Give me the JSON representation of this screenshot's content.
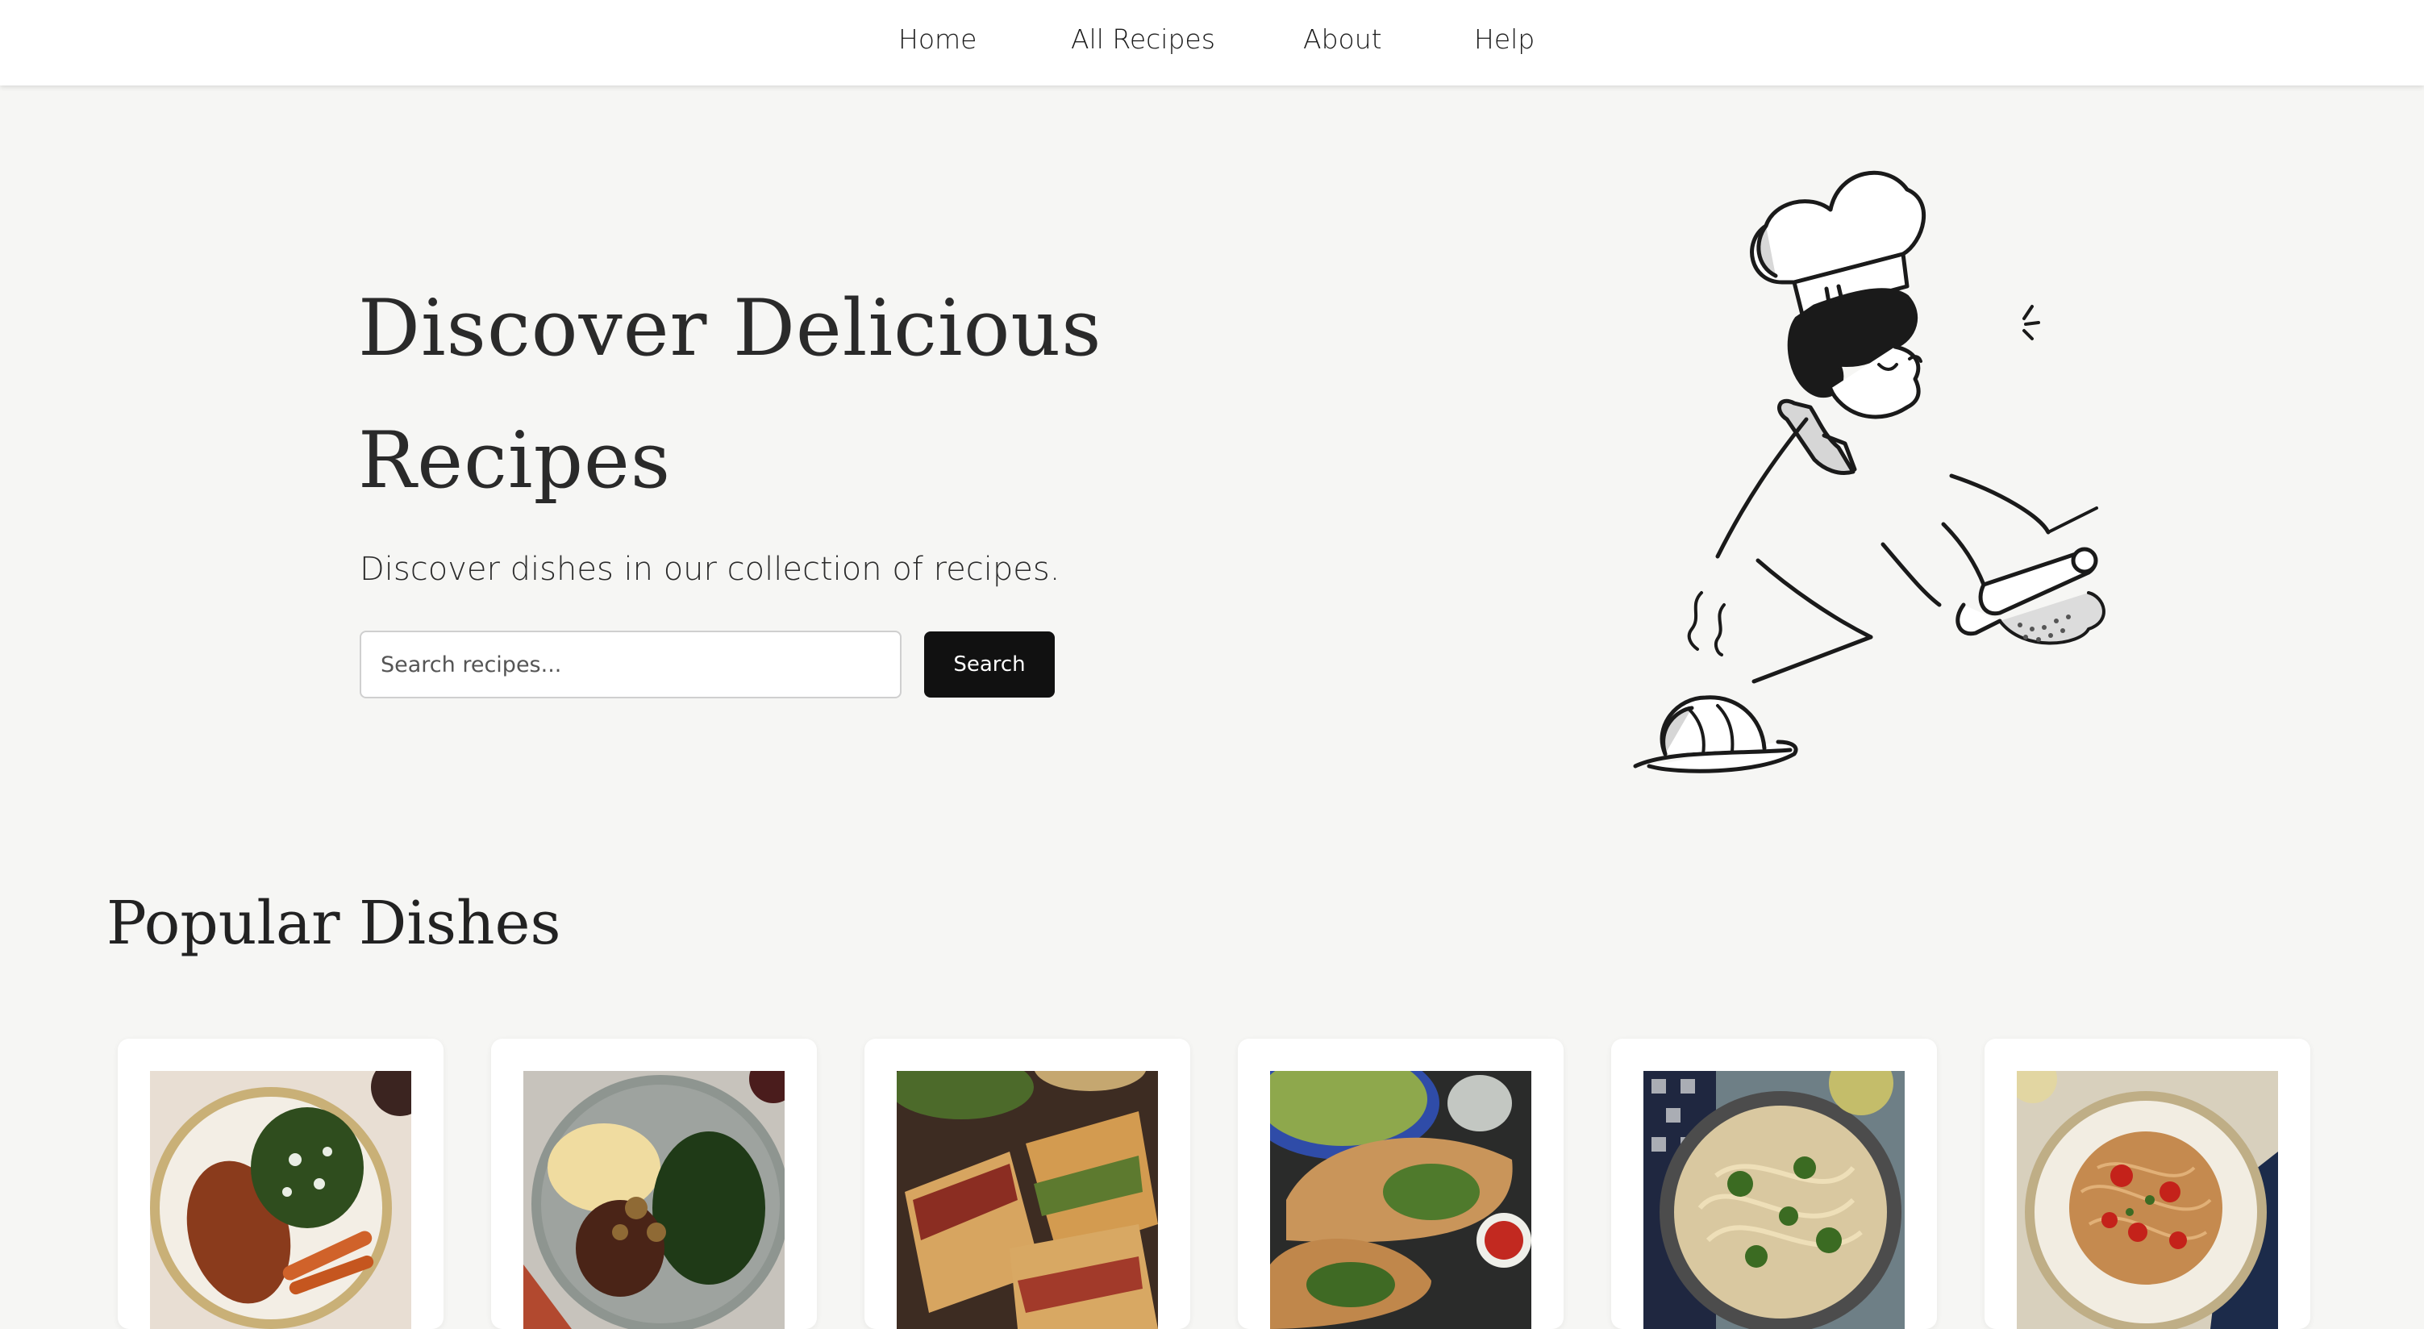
{
  "nav": {
    "links": [
      {
        "label": "Home"
      },
      {
        "label": "All Recipes"
      },
      {
        "label": "About"
      },
      {
        "label": "Help"
      }
    ]
  },
  "hero": {
    "title": "Discover Delicious Recipes",
    "subtitle": "Discover dishes in our collection of recipes.",
    "search": {
      "placeholder": "Search recipes...",
      "value": "",
      "button_label": "Search"
    },
    "illustration": "chef-rolling-dough-illustration"
  },
  "popular": {
    "title": "Popular Dishes",
    "cards": [
      {
        "image": "chicken-with-greens-and-carrots"
      },
      {
        "image": "steak-with-mashed-potatoes-and-greens"
      },
      {
        "image": "pressed-sandwich-with-salad"
      },
      {
        "image": "broccoli-calzone-with-salad"
      },
      {
        "image": "broccoli-pasta-bowl"
      },
      {
        "image": "spaghetti-with-tomatoes"
      }
    ]
  },
  "colors": {
    "background": "#f6f6f4",
    "nav_background": "#ffffff",
    "button": "#111111",
    "text": "#1f1f1f"
  }
}
